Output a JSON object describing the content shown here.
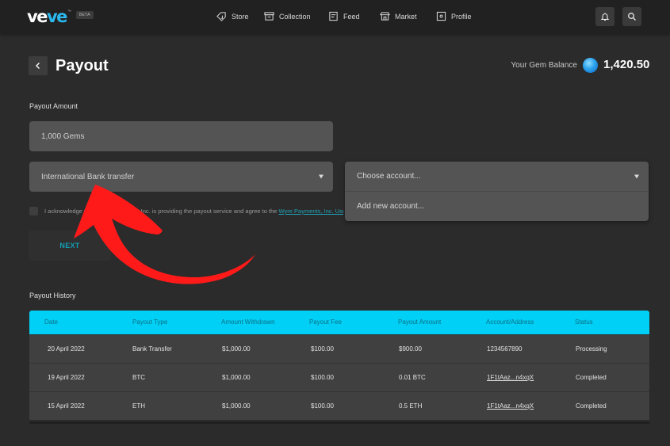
{
  "app": {
    "logo": {
      "part1": "ve",
      "part2": "ve",
      "trademark": "™",
      "badge": "BETA"
    },
    "nav": [
      {
        "label": "Store",
        "icon": "tag-icon"
      },
      {
        "label": "Collection",
        "icon": "archive-icon"
      },
      {
        "label": "Feed",
        "icon": "feed-icon"
      },
      {
        "label": "Market",
        "icon": "storefront-icon"
      },
      {
        "label": "Profile",
        "icon": "profile-icon"
      }
    ],
    "actions": {
      "notifications_icon": "bell-icon",
      "search_icon": "search-icon"
    }
  },
  "page": {
    "title": "Payout",
    "back_icon": "chevron-left-icon",
    "gem_balance_label": "Your Gem Balance",
    "gem_balance_value": "1,420.50"
  },
  "form": {
    "amount_label": "Payout Amount",
    "amount_value": "1,000 Gems",
    "method_value": "International Bank transfer",
    "account_dropdown": {
      "placeholder": "Choose account...",
      "options": [
        "Add new account..."
      ]
    },
    "acknowledge_text": "I acknowledge that Wyre Payments, Inc. is providing the payout service and agree to the ",
    "acknowledge_link": "Wyre Payments, Inc. User Agreement",
    "next_label": "NEXT"
  },
  "history": {
    "title": "Payout History",
    "columns": [
      "Date",
      "Payout Type",
      "Amount Withdrawn",
      "Payout Fee",
      "Payout Amount",
      "Account/Address",
      "Status"
    ],
    "rows": [
      [
        "20 April 2022",
        "Bank Transfer",
        "$1,000.00",
        "$100.00",
        "$900.00",
        "1234567890",
        "Processing"
      ],
      [
        "19 April 2022",
        "BTC",
        "$1,000.00",
        "$100.00",
        "0.01 BTC",
        "1F1tAaz...n4xqX",
        "Completed"
      ],
      [
        "15 April 2022",
        "ETH",
        "$1,000.00",
        "$100.00",
        "0.5 ETH",
        "1F1tAaz...n4xqX",
        "Completed"
      ]
    ]
  },
  "annotation": {
    "type": "curved-arrow",
    "color": "#ff1a1a",
    "points_to": "method_value"
  },
  "colors": {
    "accent": "#00d0f5",
    "brand_blue": "#2bb9f0",
    "link": "#1fa3b8"
  }
}
